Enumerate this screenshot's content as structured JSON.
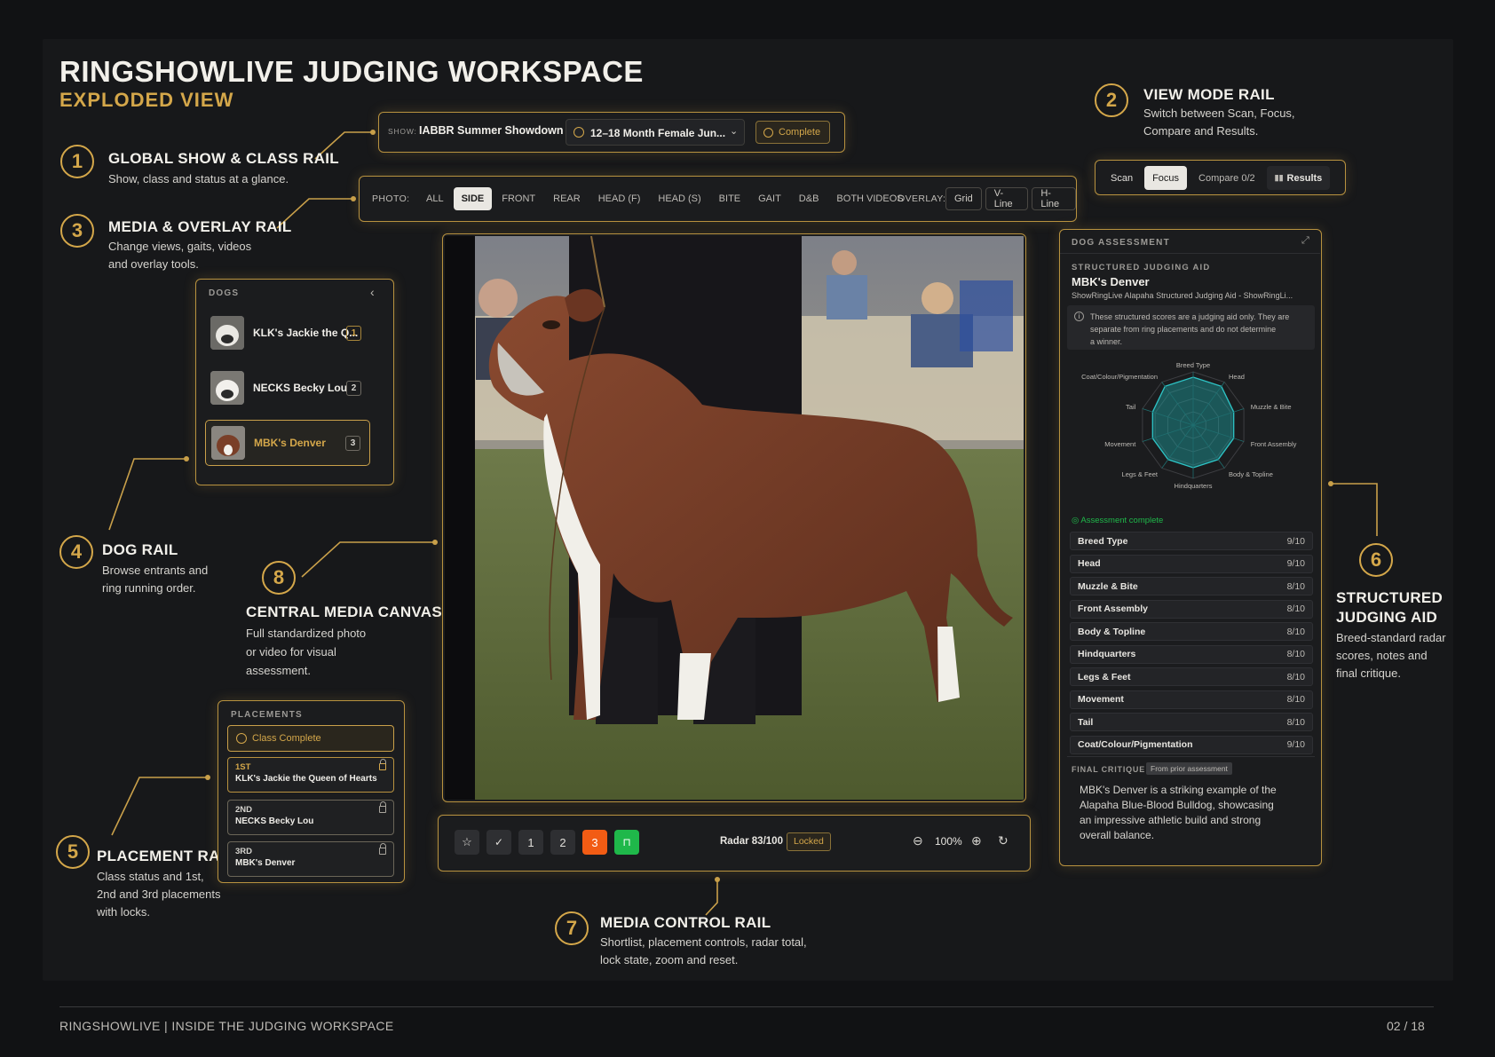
{
  "title": "RINGSHOWLIVE JUDGING WORKSPACE",
  "subtitle": "EXPLODED VIEW",
  "callouts": [
    {
      "num": "1",
      "title": "GLOBAL SHOW & CLASS RAIL",
      "desc1": "Show, class and status at a glance."
    },
    {
      "num": "2",
      "title": "VIEW MODE RAIL",
      "desc1": "Switch between Scan, Focus,",
      "desc2": "Compare and Results."
    },
    {
      "num": "3",
      "title": "MEDIA & OVERLAY RAIL",
      "desc1": "Change views, gaits, videos",
      "desc2": "and overlay tools."
    },
    {
      "num": "4",
      "title": "DOG RAIL",
      "desc1": "Browse entrants and",
      "desc2": "ring running order."
    },
    {
      "num": "5",
      "title": "PLACEMENT RAIL",
      "desc1": "Class status and 1st,",
      "desc2": "2nd and 3rd placements",
      "desc3": "with locks."
    },
    {
      "num": "6",
      "title1": "STRUCTURED",
      "title2": "JUDGING AID",
      "desc1": "Breed-standard radar",
      "desc2": "scores, notes and",
      "desc3": "final critique."
    },
    {
      "num": "7",
      "title": "MEDIA CONTROL RAIL",
      "desc1": "Shortlist, placement controls, radar total,",
      "desc2": "lock state, zoom and reset."
    },
    {
      "num": "8",
      "title": "CENTRAL MEDIA CANVAS",
      "desc1": "Full standardized photo",
      "desc2": "or video for visual",
      "desc3": "assessment."
    }
  ],
  "show_rail": {
    "show_label": "SHOW:",
    "show_name": "IABBR Summer Showdown",
    "class_name": "12–18 Month Female Jun...",
    "status": "Complete"
  },
  "media_rail": {
    "photo_label": "PHOTO:",
    "views": [
      "ALL",
      "SIDE",
      "FRONT",
      "REAR",
      "HEAD (F)",
      "HEAD (S)",
      "BITE",
      "GAIT",
      "D&B",
      "BOTH VIDEOS"
    ],
    "selected_view": "SIDE",
    "overlay_label": "OVERLAY:",
    "overlays": [
      "Grid",
      "V-Line",
      "H-Line"
    ]
  },
  "view_modes": {
    "scan": "Scan",
    "focus": "Focus",
    "compare": "Compare 0/2",
    "results": "Results",
    "active": "Focus"
  },
  "dogs": {
    "header": "DOGS",
    "items": [
      {
        "name": "KLK's Jackie the Q...",
        "order": "1"
      },
      {
        "name": "NECKS Becky Lou",
        "order": "2"
      },
      {
        "name": "MBK's Denver",
        "order": "3",
        "selected": true
      }
    ]
  },
  "placements": {
    "header": "PLACEMENTS",
    "status": "Class Complete",
    "items": [
      {
        "rank": "1ST",
        "name": "KLK's Jackie the Queen of Hearts"
      },
      {
        "rank": "2ND",
        "name": "NECKS Becky Lou"
      },
      {
        "rank": "3RD",
        "name": "MBK's Denver"
      }
    ]
  },
  "media_controls": {
    "place1": "1",
    "place2": "2",
    "place3": "3",
    "radar": "Radar 83/100",
    "lock_state": "Locked",
    "zoom": "100%"
  },
  "assessment": {
    "header": "DOG ASSESSMENT",
    "aid_label": "STRUCTURED JUDGING AID",
    "dog": "MBK's Denver",
    "source": "ShowRingLive Alapaha Structured Judging Aid - ShowRingLi...",
    "notice1": "These structured scores are a judging aid only. They are",
    "notice2": "separate from ring placements and do not determine",
    "notice3": "a winner.",
    "complete_label": "Assessment complete",
    "critique_label": "FINAL CRITIQUE",
    "critique_tag": "From prior assessment",
    "critique1": "MBK's Denver is a striking example of the",
    "critique2": "Alapaha Blue-Blood Bulldog, showcasing",
    "critique3": "an impressive athletic build and strong",
    "critique4": "overall balance.",
    "scores": [
      {
        "label": "Breed Type",
        "value": "9/10",
        "radar": "Breed Type"
      },
      {
        "label": "Head",
        "value": "9/10",
        "radar": "Head"
      },
      {
        "label": "Muzzle & Bite",
        "value": "8/10",
        "radar": "Muzzle & Bite"
      },
      {
        "label": "Front Assembly",
        "value": "8/10",
        "radar": "Front Assembly"
      },
      {
        "label": "Body & Topline",
        "value": "8/10",
        "radar": "Body & Topline"
      },
      {
        "label": "Hindquarters",
        "value": "8/10",
        "radar": "Hindquarters"
      },
      {
        "label": "Legs & Feet",
        "value": "8/10",
        "radar": "Legs & Feet"
      },
      {
        "label": "Movement",
        "value": "8/10",
        "radar": "Movement"
      },
      {
        "label": "Tail",
        "value": "8/10",
        "radar": "Tail"
      },
      {
        "label": "Coat/Colour/Pigmentation",
        "value": "9/10",
        "radar": "Coat/Colour/Pigmentation"
      }
    ]
  },
  "footer": {
    "left": "RINGSHOWLIVE | INSIDE THE JUDGING WORKSPACE",
    "right": "02 / 18"
  },
  "colors": {
    "accent": "#d4a74a",
    "background": "#17181a",
    "place3": "#f25c14",
    "lock": "#1fb84a",
    "radar": "#1c9fa0"
  }
}
